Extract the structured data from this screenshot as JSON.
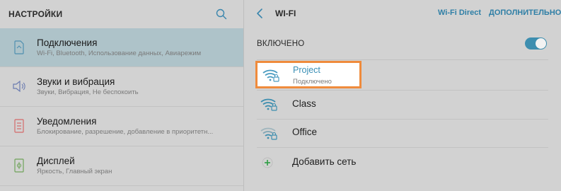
{
  "settings": {
    "title": "НАСТРОЙКИ",
    "items": [
      {
        "icon": "connections-icon",
        "title": "Подключения",
        "subtitle": "Wi-Fi, Bluetooth, Использование данных, Авиарежим",
        "selected": true
      },
      {
        "icon": "sound-icon",
        "title": "Звуки и вибрация",
        "subtitle": "Звуки, Вибрация, Не беспокоить",
        "selected": false
      },
      {
        "icon": "notifications-icon",
        "title": "Уведомления",
        "subtitle": "Блокирование, разрешение, добавление в приоритетн...",
        "selected": false
      },
      {
        "icon": "display-icon",
        "title": "Дисплей",
        "subtitle": "Яркость, Главный экран",
        "selected": false
      }
    ]
  },
  "wifi": {
    "title": "WI-FI",
    "wifi_direct": "Wi-Fi Direct",
    "more": "ДОПОЛНИТЕЛЬНО",
    "enabled_label": "ВКЛЮЧЕНО",
    "enabled": true,
    "networks": [
      {
        "name": "Project",
        "status": "Подключено",
        "connected": true,
        "secured": true
      },
      {
        "name": "Class",
        "status": "",
        "connected": false,
        "secured": true
      },
      {
        "name": "Office",
        "status": "",
        "connected": false,
        "secured": true
      }
    ],
    "add_network": "Добавить сеть"
  },
  "colors": {
    "accent": "#2f86ad",
    "highlight_border": "#ef8b3c",
    "selected_row": "#aec3c9",
    "add_icon": "#2e9e44"
  }
}
